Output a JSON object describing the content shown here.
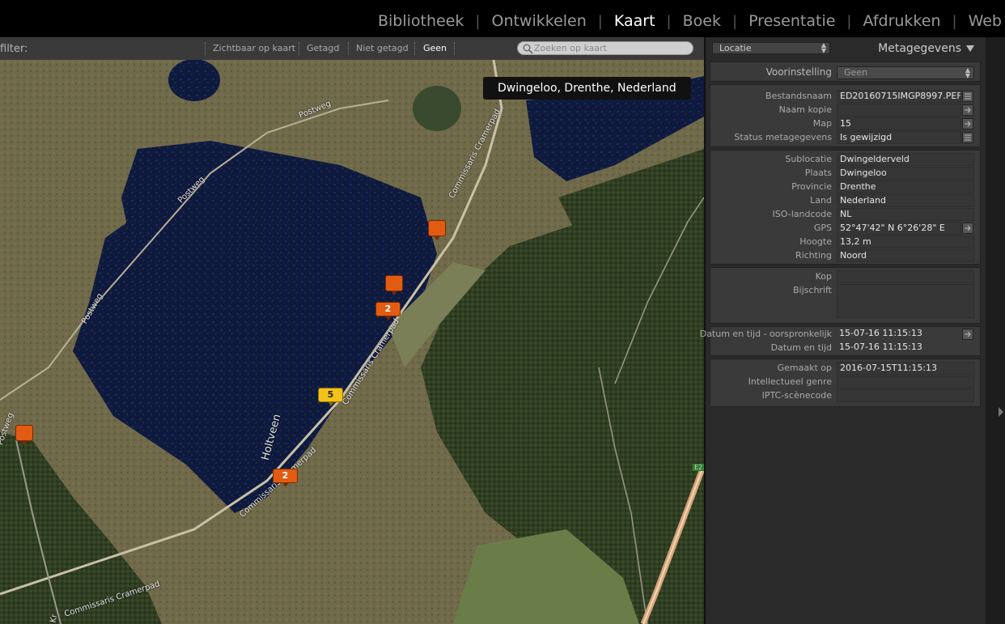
{
  "modules": [
    "Bibliotheek",
    "Ontwikkelen",
    "Kaart",
    "Boek",
    "Presentatie",
    "Afdrukken",
    "Web"
  ],
  "active_module": "Kaart",
  "filterbar": {
    "label": "filter:",
    "options": [
      "Zichtbaar op kaart",
      "Getagd",
      "Niet getagd",
      "Geen"
    ],
    "active_option": "Geen",
    "search_placeholder": "Zoeken op kaart"
  },
  "map": {
    "tooltip": "Dwingeloo, Drenthe, Nederland",
    "road_labels": [
      "Postweg",
      "Postweg",
      "Postweg",
      "Postweg",
      "Commissaris Cramerpad",
      "Commissaris Cramerpad",
      "Commissaris Cramerpad",
      "Commissaris Cramerpad",
      "Holtveen",
      "E2",
      "Kr"
    ],
    "pins": [
      {
        "type": "single"
      },
      {
        "type": "single"
      },
      {
        "type": "cluster",
        "count": "2"
      },
      {
        "type": "cluster",
        "count": "5",
        "selected": true
      },
      {
        "type": "cluster",
        "count": "2"
      },
      {
        "type": "single"
      }
    ]
  },
  "panel": {
    "view_select": "Locatie",
    "title": "Metagegevens",
    "preset_label": "Voorinstelling",
    "preset_value": "Geen",
    "file_section": [
      {
        "label": "Bestandsnaam",
        "value": "ED20160715IMGP8997.PEF",
        "button": "list"
      },
      {
        "label": "Naam kopie",
        "value": "",
        "button": "arrow"
      },
      {
        "label": "Map",
        "value": "15",
        "button": "arrow"
      },
      {
        "label": "Status metagegevens",
        "value": "Is gewijzigd",
        "button": "list"
      }
    ],
    "location_section": [
      {
        "label": "Sublocatie",
        "value": "Dwingelderveld"
      },
      {
        "label": "Plaats",
        "value": "Dwingeloo"
      },
      {
        "label": "Provincie",
        "value": "Drenthe"
      },
      {
        "label": "Land",
        "value": "Nederland"
      },
      {
        "label": "ISO-landcode",
        "value": "NL"
      },
      {
        "label": "GPS",
        "value": "52°47'42\" N 6°26'28\" E",
        "button": "arrow"
      },
      {
        "label": "Hoogte",
        "value": "13,2 m"
      },
      {
        "label": "Richting",
        "value": "Noord"
      }
    ],
    "caption_section": [
      {
        "label": "Kop",
        "value": ""
      },
      {
        "label": "Bijschrift",
        "value": ""
      }
    ],
    "date_section": [
      {
        "label": "Datum en tijd - oorspronkelijk",
        "value": "15-07-16 11:15:13",
        "button": "arrow"
      },
      {
        "label": "Datum en tijd",
        "value": "15-07-16 11:15:13"
      }
    ],
    "iptc_section": [
      {
        "label": "Gemaakt op",
        "value": "2016-07-15T11:15:13"
      },
      {
        "label": "Intellectueel genre",
        "value": ""
      },
      {
        "label": "IPTC-scènecode",
        "value": ""
      }
    ]
  },
  "colors": {
    "pin_orange": "#e25b13",
    "pin_selected": "#f2c21a",
    "water": "#0f1a3f"
  }
}
